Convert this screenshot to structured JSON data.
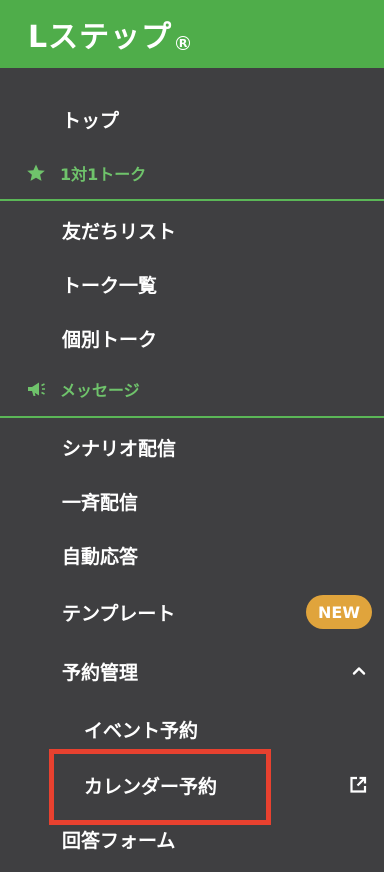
{
  "brand": {
    "logo_text": "Lステップ",
    "logo_mark": "R"
  },
  "menu": {
    "top": "トップ",
    "section_talk": "1対1トーク",
    "friends": "友だちリスト",
    "talk_list": "トーク一覧",
    "personal_talk": "個別トーク",
    "section_message": "メッセージ",
    "scenario": "シナリオ配信",
    "broadcast": "一斉配信",
    "auto_reply": "自動応答",
    "template": "テンプレート",
    "template_badge": "NEW",
    "reservation": "予約管理",
    "event_reservation": "イベント予約",
    "calendar_reservation": "カレンダー予約",
    "answer_form": "回答フォーム"
  },
  "icons": {
    "talk_section": "star-icon",
    "message_section": "megaphone-icon",
    "reservation_toggle": "chevron-up-icon",
    "calendar_link": "external-link-icon"
  },
  "colors": {
    "header": "#4fad4a",
    "sidebar": "#3f3f41",
    "section_text": "#6fc36b",
    "badge": "#e0a43c",
    "highlight": "#e8412f"
  }
}
